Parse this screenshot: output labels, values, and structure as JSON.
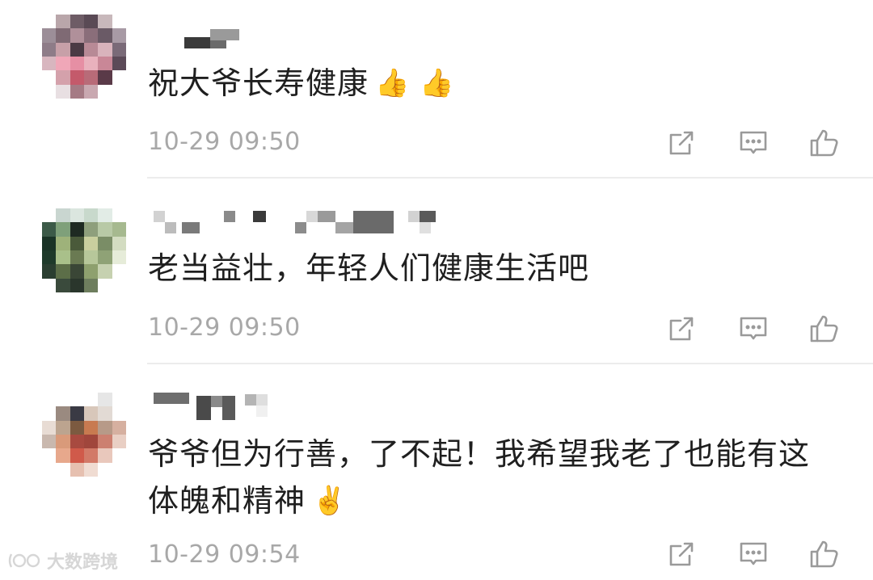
{
  "comments": [
    {
      "text": "祝大爷长寿健康",
      "emoji": "👍 👍",
      "time": "10-29 09:50"
    },
    {
      "text": "老当益壮，年轻人们健康生活吧",
      "emoji": "",
      "time": "10-29 09:50"
    },
    {
      "text_line1": "爷爷但为行善，了不起！我希望我老了也能有这",
      "text_line2": "体魄和精神",
      "emoji": "✌️",
      "time": "10-29 09:54"
    }
  ],
  "icons": {
    "share": "share-icon",
    "reply": "comment-icon",
    "like": "thumbs-up-icon"
  },
  "watermark": {
    "text": "大数跨境"
  },
  "colors": {
    "text": "#1f1f1f",
    "timestamp": "#a8a8a8",
    "icon": "#9a9a9a",
    "divider": "#ececec"
  }
}
